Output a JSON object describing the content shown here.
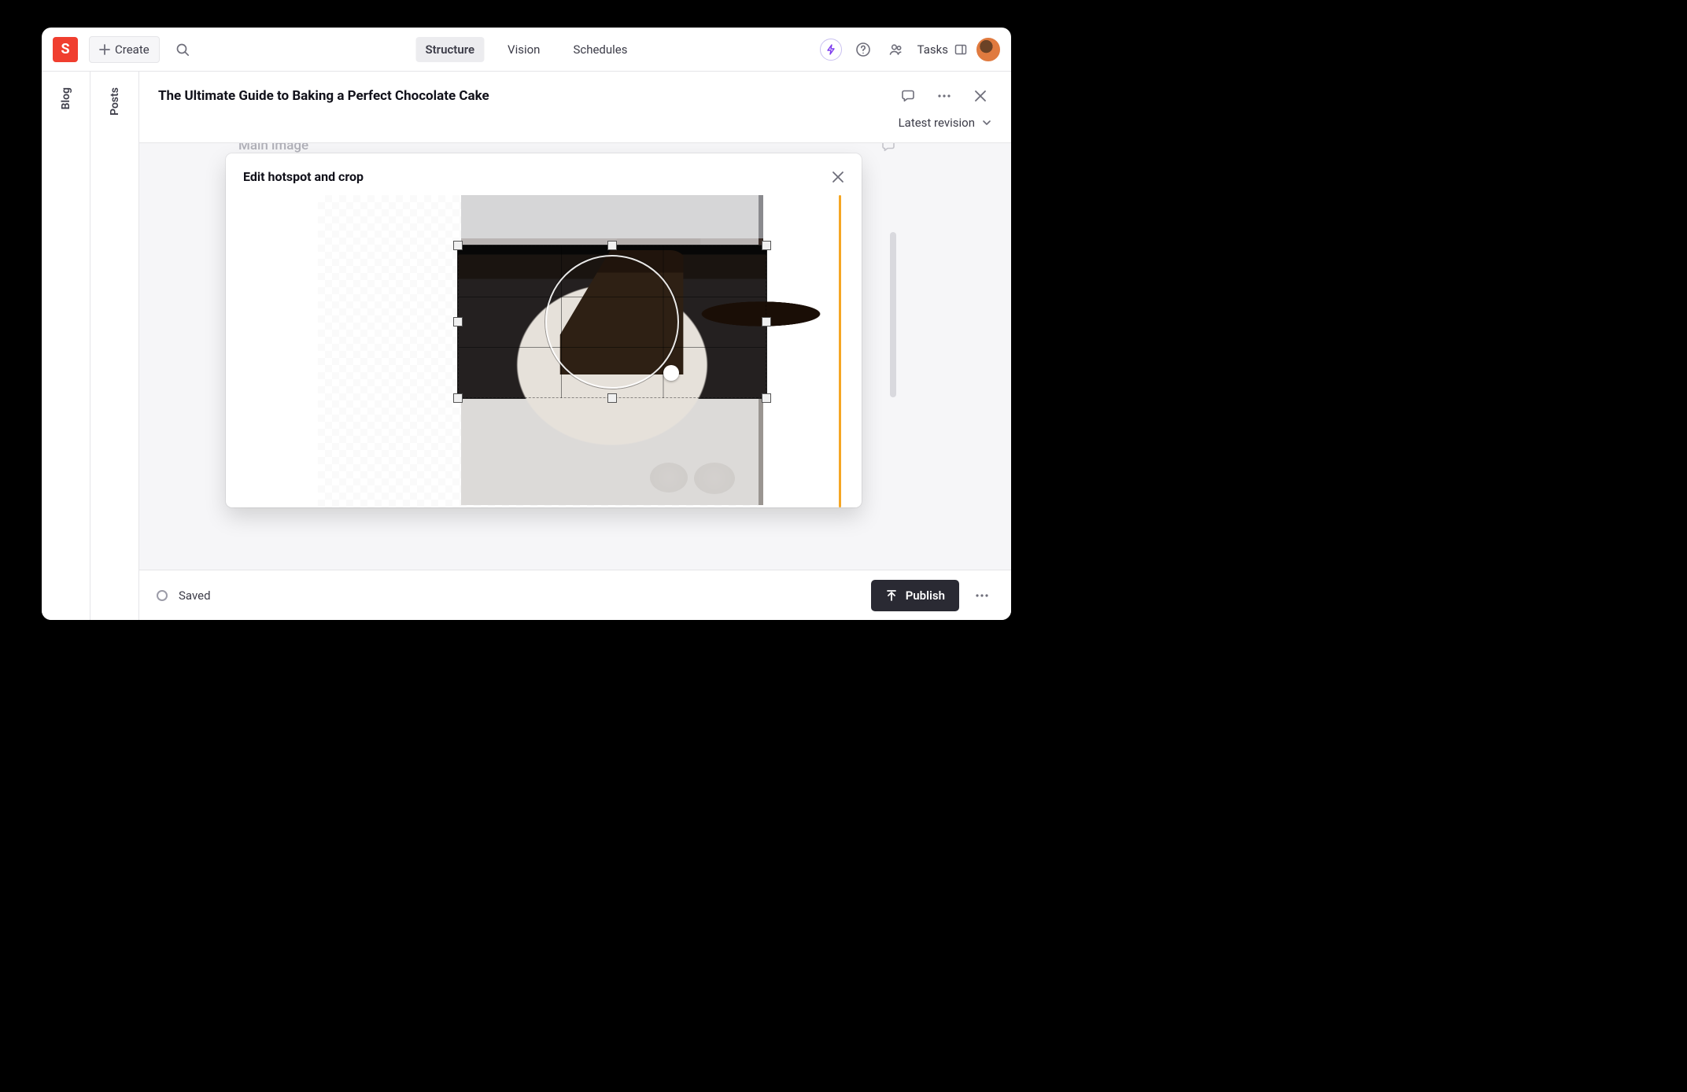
{
  "brand_letter": "S",
  "nav": {
    "create_label": "Create",
    "items": [
      "Structure",
      "Vision",
      "Schedules"
    ],
    "active_index": 0,
    "tasks_label": "Tasks"
  },
  "rails": [
    "Blog",
    "Posts"
  ],
  "document": {
    "title": "The Ultimate Guide to Baking a Perfect Chocolate Cake",
    "revision_label": "Latest revision",
    "field_label_behind": "Main image"
  },
  "modal": {
    "title": "Edit hotspot and crop"
  },
  "footer": {
    "status": "Saved",
    "publish_label": "Publish"
  },
  "colors": {
    "brand": "#f03e2f",
    "accent": "#f5a623"
  }
}
